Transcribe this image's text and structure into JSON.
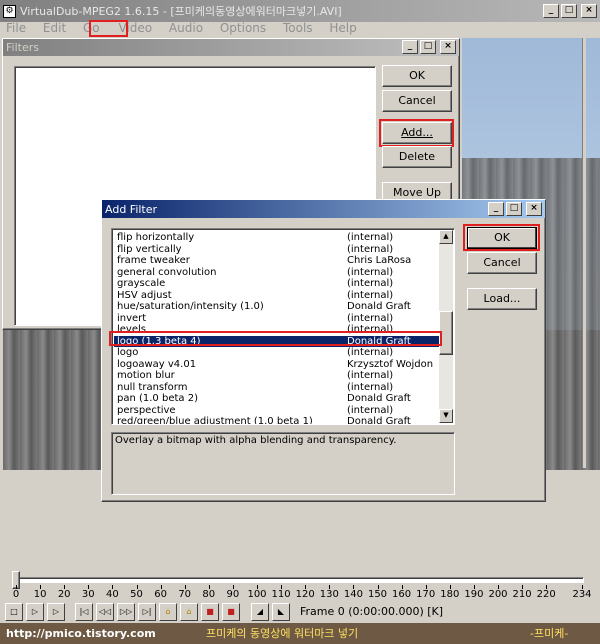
{
  "main_window": {
    "app_icon": "virtualdub-icon",
    "title": "VirtualDub-MPEG2 1.6.15 - [프미케의동영상에워터마크넣기.AVI]",
    "menu": [
      "File",
      "Edit",
      "Go",
      "Video",
      "Audio",
      "Options",
      "Tools",
      "Help"
    ],
    "highlight_menu": "Video"
  },
  "filters_dialog": {
    "title": "Filters",
    "buttons": [
      "OK",
      "Cancel",
      "Add...",
      "Delete",
      "Move Up"
    ]
  },
  "add_filter_dialog": {
    "title": "Add Filter",
    "buttons": {
      "ok": "OK",
      "cancel": "Cancel",
      "load": "Load..."
    },
    "filters": [
      {
        "name": "flip horizontally",
        "author": "(internal)"
      },
      {
        "name": "flip vertically",
        "author": "(internal)"
      },
      {
        "name": "frame tweaker",
        "author": "Chris LaRosa"
      },
      {
        "name": "general convolution",
        "author": "(internal)"
      },
      {
        "name": "grayscale",
        "author": "(internal)"
      },
      {
        "name": "HSV adjust",
        "author": "(internal)"
      },
      {
        "name": "hue/saturation/intensity (1.0)",
        "author": "Donald Graft"
      },
      {
        "name": "invert",
        "author": "(internal)"
      },
      {
        "name": "levels",
        "author": "(internal)"
      },
      {
        "name": "logo (1.3 beta 4)",
        "author": "Donald Graft",
        "selected": true
      },
      {
        "name": "logo",
        "author": "(internal)"
      },
      {
        "name": "logoaway v4.01",
        "author": "Krzysztof Wojdon"
      },
      {
        "name": "motion blur",
        "author": "(internal)"
      },
      {
        "name": "null transform",
        "author": "(internal)"
      },
      {
        "name": "pan (1.0 beta 2)",
        "author": "Donald Graft"
      },
      {
        "name": "perspective",
        "author": "(internal)"
      },
      {
        "name": "red/green/blue adjustment (1.0 beta 1)",
        "author": "Donald Graft"
      }
    ],
    "description": "Overlay a bitmap with alpha blending and transparency."
  },
  "timeline": {
    "ticks": [
      "0",
      "10",
      "20",
      "30",
      "40",
      "50",
      "60",
      "70",
      "80",
      "90",
      "100",
      "110",
      "120",
      "130",
      "140",
      "150",
      "160",
      "170",
      "180",
      "190",
      "200",
      "210",
      "220",
      "234"
    ],
    "frame_label": "Frame 0 (0:00:00.000) [K]"
  },
  "footer": {
    "url": "http://pmico.tistory.com",
    "message": "프미케의 동영상에 워터마크 넣기",
    "brand": "-프미케-"
  },
  "colors": {
    "highlight": "#e02020",
    "selection": "#0a246a",
    "title_active": "#0a246a"
  }
}
